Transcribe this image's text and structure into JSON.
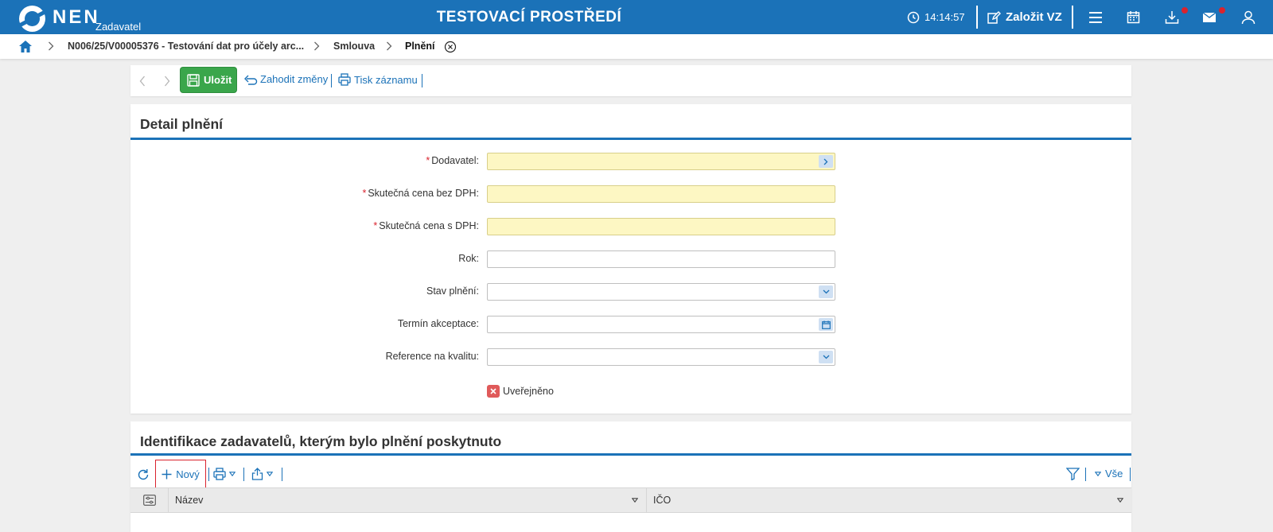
{
  "app": {
    "logo_text": "NEN",
    "logo_sub": "Zadavatel",
    "env_title": "TESTOVACÍ PROSTŘEDÍ",
    "clock": "14:14:57",
    "create_label": "Založit VZ"
  },
  "breadcrumb": {
    "items": [
      {
        "label": "N006/25/V00005376 - Testování dat pro účely arc..."
      },
      {
        "label": "Smlouva"
      },
      {
        "label": "Plnění"
      }
    ]
  },
  "toolbar": {
    "save_label": "Uložit",
    "discard_label": "Zahodit změny",
    "print_label": "Tisk záznamu"
  },
  "detail": {
    "title": "Detail plnění",
    "fields": [
      {
        "label": "Dodavatel:",
        "required": true
      },
      {
        "label": "Skutečná cena bez DPH:",
        "required": true
      },
      {
        "label": "Skutečná cena s DPH:",
        "required": true
      },
      {
        "label": "Rok:",
        "required": false
      },
      {
        "label": "Stav plnění:",
        "required": false
      },
      {
        "label": "Termín akceptace:",
        "required": false
      },
      {
        "label": "Reference na kvalitu:",
        "required": false
      }
    ],
    "published_label": "Uveřejněno"
  },
  "identification": {
    "title": "Identifikace zadavatelů, kterým bylo plnění poskytnuto",
    "new_label": "Nový",
    "filter_all_label": "Vše",
    "columns": [
      "Název",
      "IČO"
    ]
  },
  "colors": {
    "brand_blue": "#1b72b8",
    "save_green": "#3aa64b",
    "required_yellow": "#fdf7c3",
    "alert_red": "#d9232e"
  }
}
